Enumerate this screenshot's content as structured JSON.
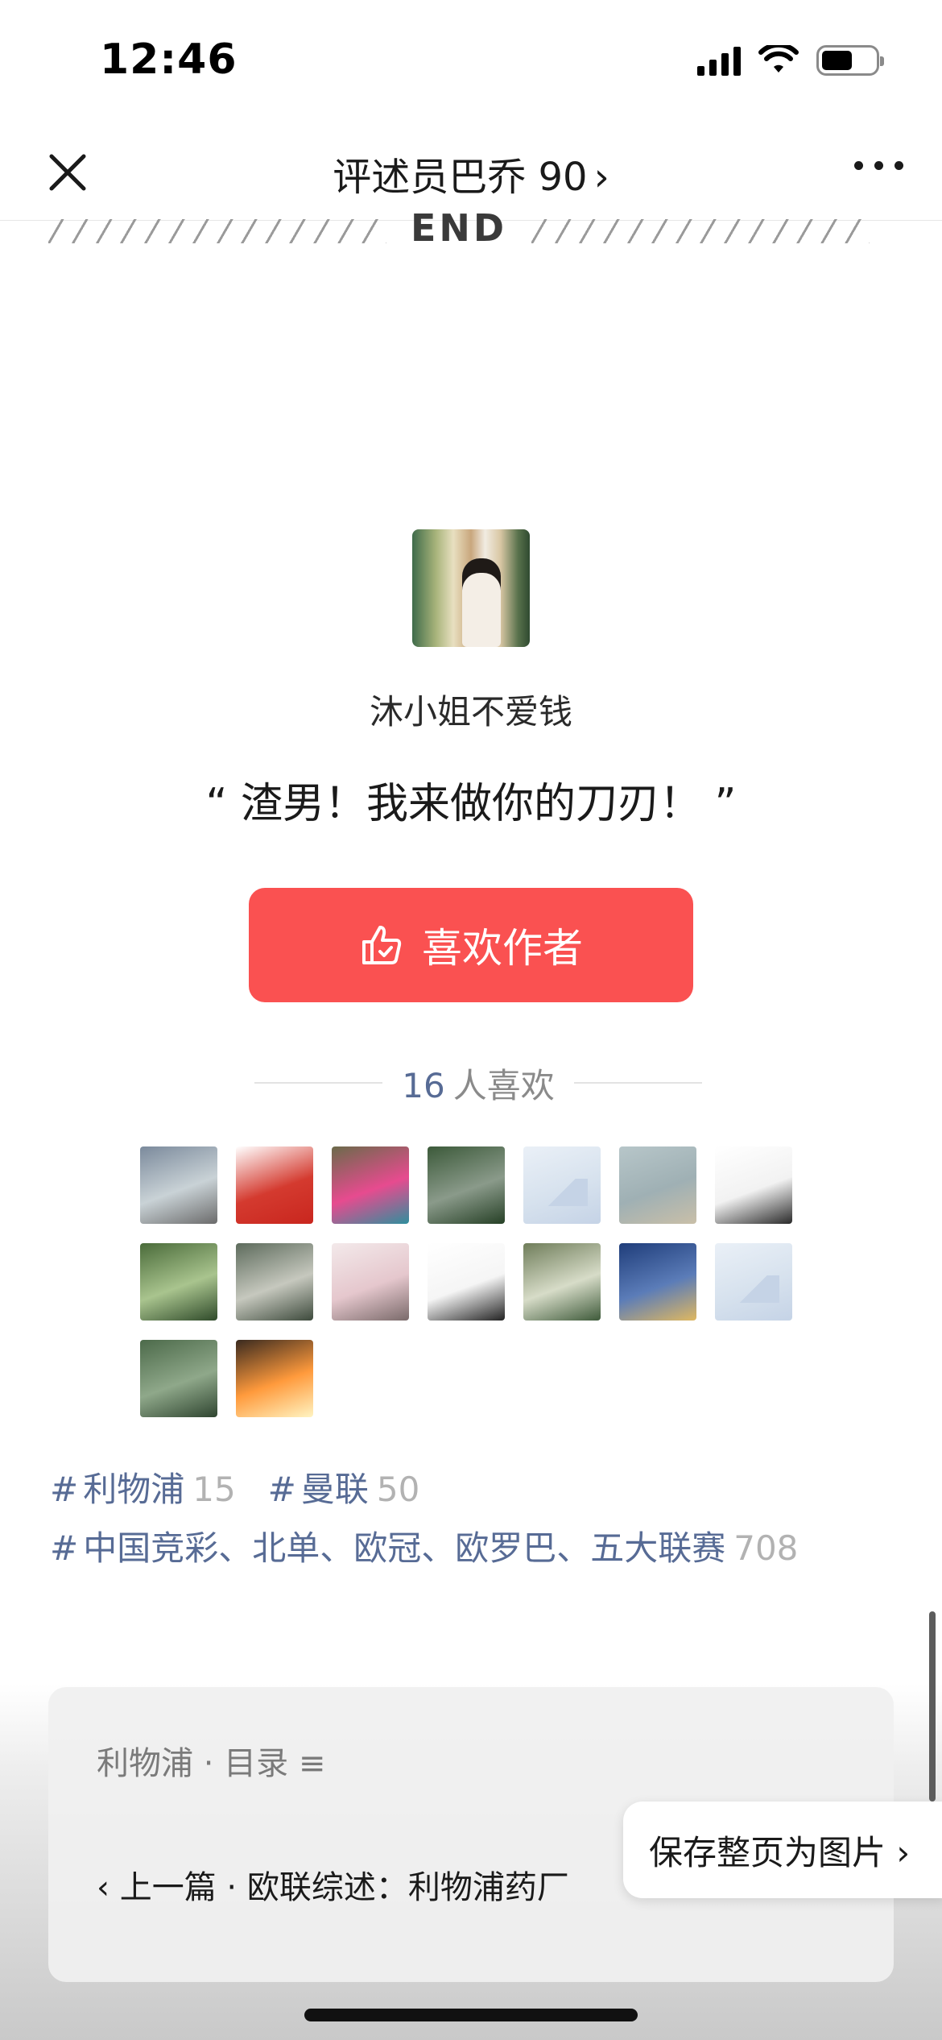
{
  "status_bar": {
    "time": "12:46"
  },
  "nav": {
    "title": "评述员巴乔 90",
    "chevron": "›"
  },
  "end_divider": {
    "text": "END"
  },
  "author": {
    "name": "沐小姐不爱钱",
    "quote": "“ 渣男！我来做你的刀刃！ ”"
  },
  "like_button": {
    "label": "喜欢作者",
    "icon": "thumbs-up-check-icon",
    "color": "#fa5151"
  },
  "likes": {
    "count": "16",
    "suffix": "人喜欢"
  },
  "likers": [
    {
      "colors": [
        "#7b8a9c",
        "#c9d2d6",
        "#6b6b6b"
      ]
    },
    {
      "colors": [
        "#ffffff",
        "#d43a2f",
        "#c9261e"
      ]
    },
    {
      "colors": [
        "#6b6b4a",
        "#e74b8f",
        "#2f8f9d"
      ]
    },
    {
      "colors": [
        "#3c5a3a",
        "#8a9a8a",
        "#264026"
      ]
    },
    {
      "colors": [
        "#eaf0f7",
        "#d7e2ee",
        "#c5d3e6"
      ],
      "placeholder": true
    },
    {
      "colors": [
        "#b7c6c9",
        "#9fb0b4",
        "#c9bfa8"
      ]
    },
    {
      "colors": [
        "#ffffff",
        "#f2f2f2",
        "#2a2a2a"
      ]
    },
    {
      "colors": [
        "#4a6b3a",
        "#a9c48e",
        "#2f4a2a"
      ]
    },
    {
      "colors": [
        "#5d6b5c",
        "#c6c8be",
        "#3d4a3c"
      ]
    },
    {
      "colors": [
        "#f3e9ea",
        "#e5c7cd",
        "#7a6a6a"
      ]
    },
    {
      "colors": [
        "#ffffff",
        "#f5f5f5",
        "#222222"
      ]
    },
    {
      "colors": [
        "#6f7d5a",
        "#d7dcc8",
        "#3e5a3a"
      ]
    },
    {
      "colors": [
        "#1f3d7a",
        "#5b7cb8",
        "#e0b860"
      ]
    },
    {
      "colors": [
        "#eaf0f7",
        "#d7e2ee",
        "#c5d3e6"
      ],
      "placeholder": true
    },
    {
      "colors": [
        "#4c6a4a",
        "#8fa88a",
        "#2f4530"
      ]
    },
    {
      "colors": [
        "#3a2a1f",
        "#ff9a3c",
        "#fff4c2"
      ]
    }
  ],
  "tags": [
    {
      "name": "利物浦",
      "count": "15"
    },
    {
      "name": "曼联",
      "count": "50"
    },
    {
      "name": "中国竞彩、北单、欧冠、欧罗巴、五大联赛",
      "count": "708"
    }
  ],
  "album": {
    "title": "利物浦 · 目录 ≡",
    "prev_article": "‹ 上一篇 · 欧联综述：利物浦药厂"
  },
  "save_page": {
    "label": "保存整页为图片 ›"
  }
}
